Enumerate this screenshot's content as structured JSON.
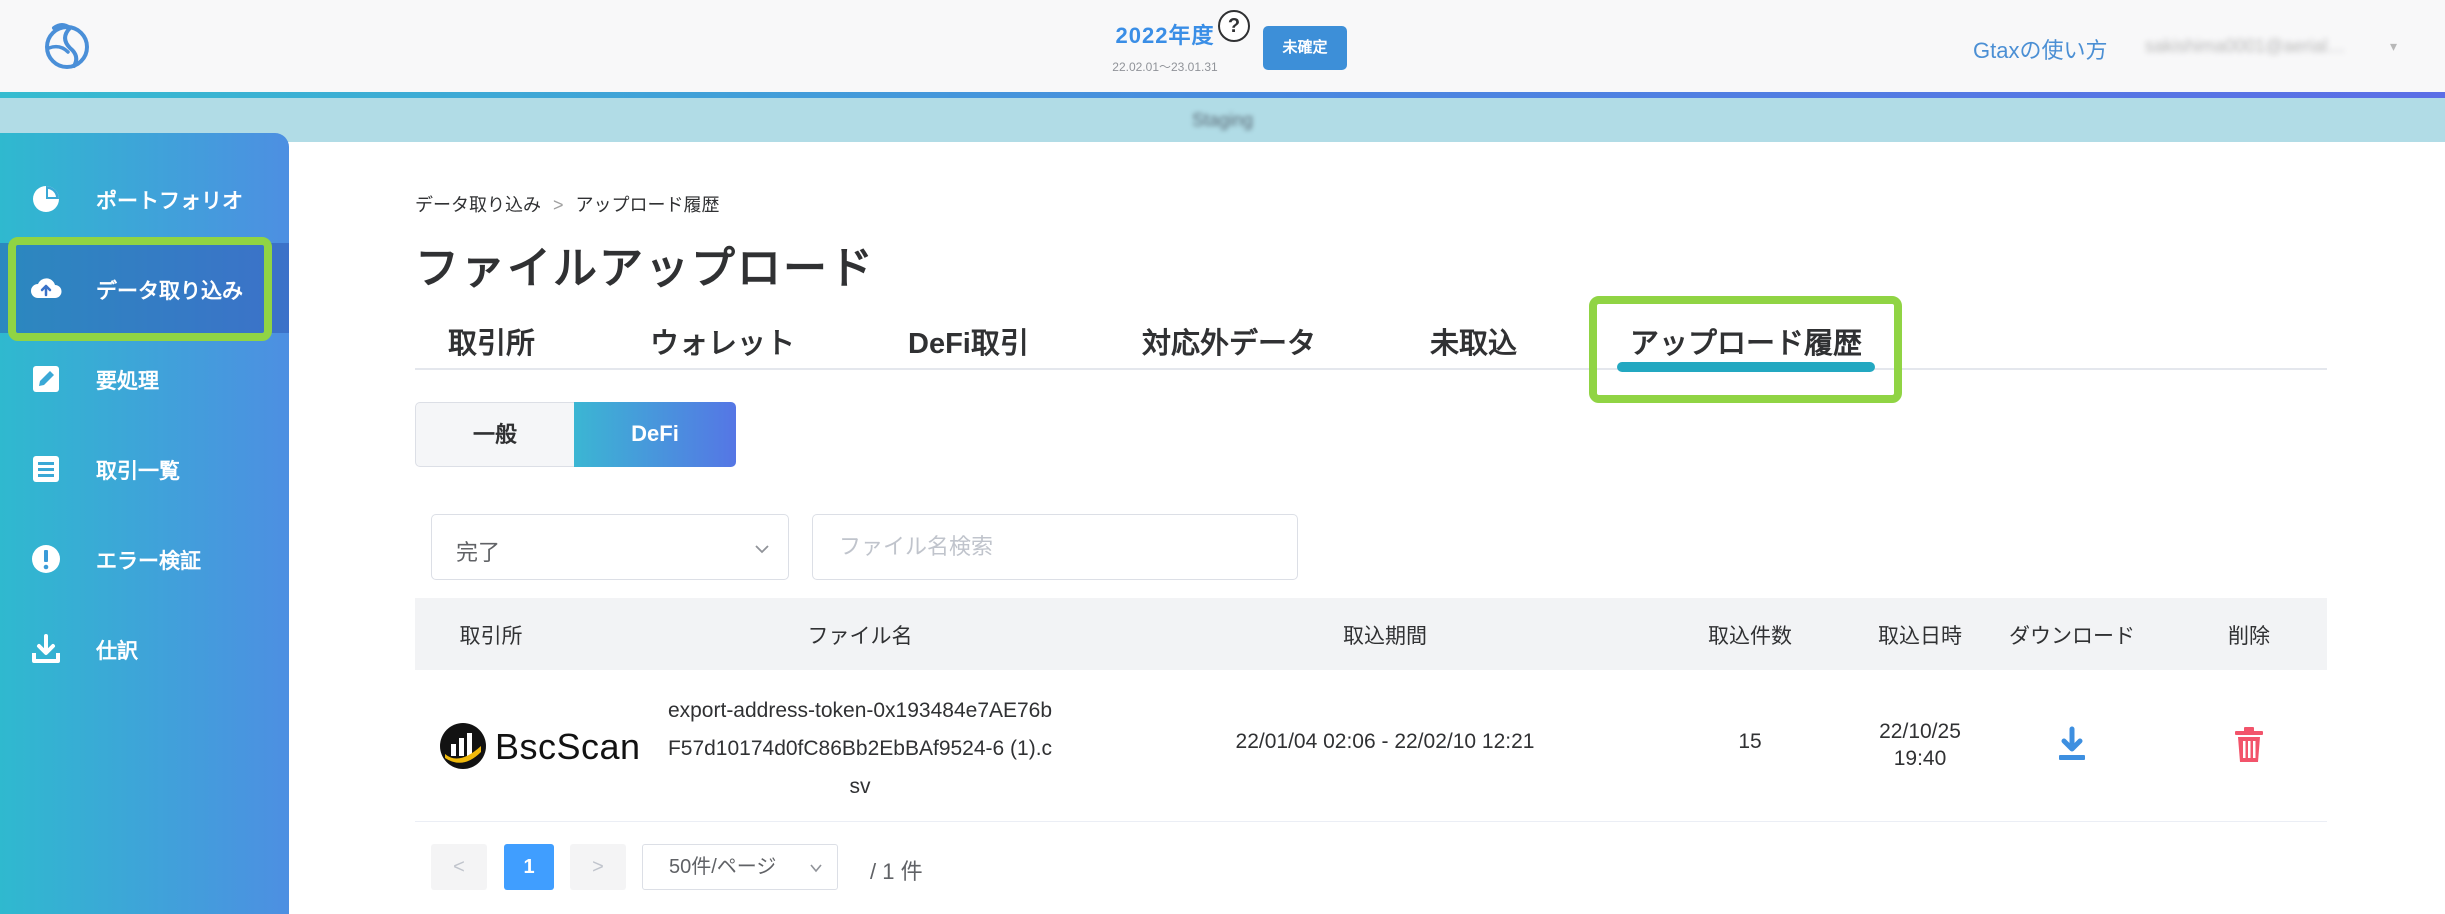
{
  "header": {
    "fiscal_year": "2022年度",
    "fiscal_range": "22.02.01〜23.01.31",
    "help_symbol": "?",
    "status_button": "未確定",
    "howto_link": "Gtaxの使い方",
    "user_email": "sakishima0001@aerial…",
    "user_caret": "▾"
  },
  "notice": {
    "text": "Staging"
  },
  "sidebar": {
    "items": [
      {
        "label": "ポートフォリオ",
        "icon": "pie-chart-icon"
      },
      {
        "label": "データ取り込み",
        "icon": "cloud-upload-icon"
      },
      {
        "label": "要処理",
        "icon": "edit-icon"
      },
      {
        "label": "取引一覧",
        "icon": "list-icon"
      },
      {
        "label": "エラー検証",
        "icon": "alert-icon"
      },
      {
        "label": "仕訳",
        "icon": "download-icon"
      }
    ],
    "active_index": 1
  },
  "breadcrumb": {
    "parent": "データ取り込み",
    "separator": ">",
    "current": "アップロード履歴"
  },
  "page_title": "ファイルアップロード",
  "tabs": [
    "取引所",
    "ウォレット",
    "DeFi取引",
    "対応外データ",
    "未取込",
    "アップロード履歴"
  ],
  "active_tab": "アップロード履歴",
  "segment": {
    "general": "一般",
    "defi": "DeFi",
    "selected": "DeFi"
  },
  "filters": {
    "status_value": "完了",
    "search_placeholder": "ファイル名検索",
    "search_value": ""
  },
  "table": {
    "headers": [
      "取引所",
      "ファイル名",
      "取込期間",
      "取込件数",
      "取込日時",
      "ダウンロード",
      "削除"
    ],
    "rows": [
      {
        "exchange": "BscScan",
        "file_name": "export-address-token-0x193484e7AE76bF57d10174d0fC86Bb2EbBAf9524-6 (1).csv",
        "period": "22/01/04 02:06 - 22/02/10 12:21",
        "count": "15",
        "date_line1": "22/10/25",
        "date_line2": "19:40"
      }
    ]
  },
  "pagination": {
    "prev": "<",
    "page": "1",
    "next": ">",
    "page_size": "50件/ページ",
    "total": "/ 1 件"
  },
  "colors": {
    "accent": "#409eff",
    "highlight": "#90d444",
    "tab_underline": "#23a8c1",
    "delete": "#f2546b",
    "download": "#3d8fe0"
  }
}
